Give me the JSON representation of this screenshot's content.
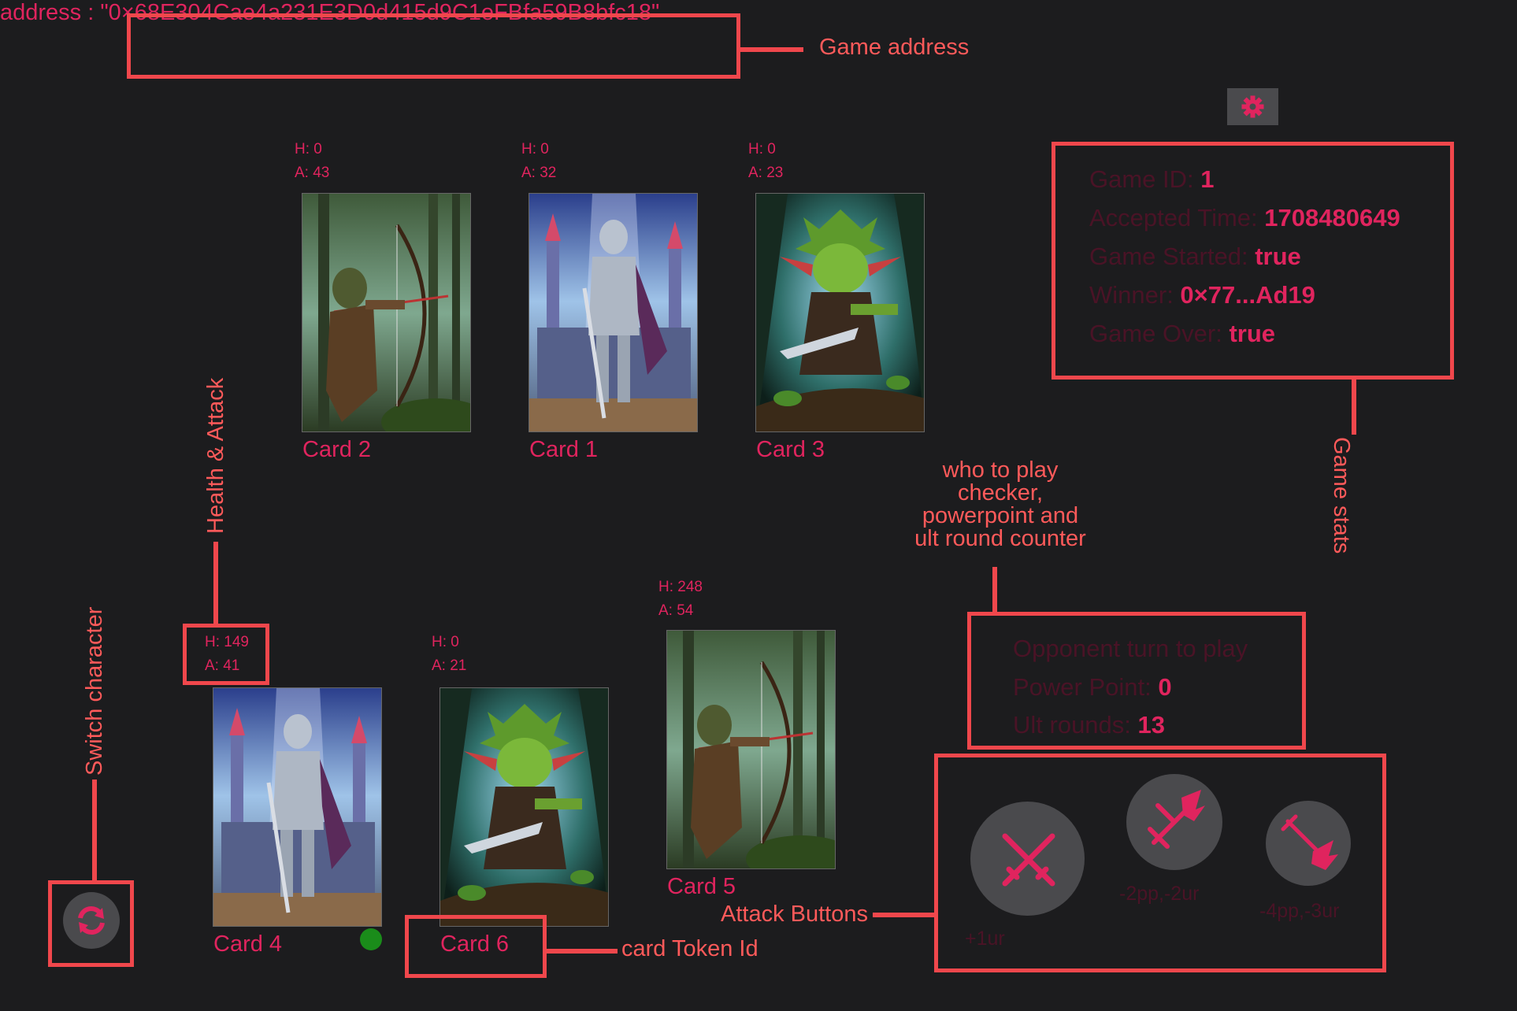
{
  "header": {
    "address_text": "address : \"0×68E304Cae4a231E3D0d415d9C1eFBfa59B8bfc18\""
  },
  "settings": {
    "icon": "gear-icon"
  },
  "stats": {
    "game_id_label": "Game ID: ",
    "game_id": "1",
    "accepted_label": "Accepted Time: ",
    "accepted": "1708480649",
    "started_label": "Game Started: ",
    "started": "true",
    "winner_label": "Winner: ",
    "winner": "0×77...Ad19",
    "over_label": "Game Over: ",
    "over": "true"
  },
  "opponent_cards": [
    {
      "h": "H: 0",
      "a": "A: 43",
      "label": "Card 2",
      "art": "archer"
    },
    {
      "h": "H: 0",
      "a": "A: 32",
      "label": "Card 1",
      "art": "knight"
    },
    {
      "h": "H: 0",
      "a": "A: 23",
      "label": "Card 3",
      "art": "goblin"
    }
  ],
  "player_cards": [
    {
      "h": "H: 149",
      "a": "A: 41",
      "label": "Card 4",
      "art": "knight"
    },
    {
      "h": "H: 0",
      "a": "A: 21",
      "label": "Card 6",
      "art": "goblin"
    },
    {
      "h": "H: 248",
      "a": "A: 54",
      "label": "Card 5",
      "art": "archer"
    }
  ],
  "turn": {
    "status": "Opponent turn to play",
    "power_label": "Power Point: ",
    "power": "0",
    "ult_label": "Ult rounds: ",
    "ult": "13"
  },
  "attacks": [
    {
      "icon": "crossed-swords-icon",
      "cost": "+1ur"
    },
    {
      "icon": "flaming-sword-icon",
      "cost": "-2pp,-2ur"
    },
    {
      "icon": "fire-sword-icon",
      "cost": "-4pp,-3ur"
    }
  ],
  "switch": {
    "icon": "refresh-icon"
  },
  "annotations": {
    "game_address": "Game address",
    "game_stats": "Game stats",
    "health_attack": "Health & Attack",
    "switch_character": "Switch character",
    "turn_checker_1": "who to play",
    "turn_checker_2": "checker,",
    "turn_checker_3": "powerpoint and",
    "turn_checker_4": "ult round counter",
    "attack_buttons": "Attack Buttons",
    "card_token_id": "card Token Id"
  },
  "colors": {
    "accent": "#e0245e",
    "annotation": "#f0474c",
    "background": "#1c1c1e",
    "button": "#4a4a4d",
    "active_dot": "#1a8c1a"
  }
}
